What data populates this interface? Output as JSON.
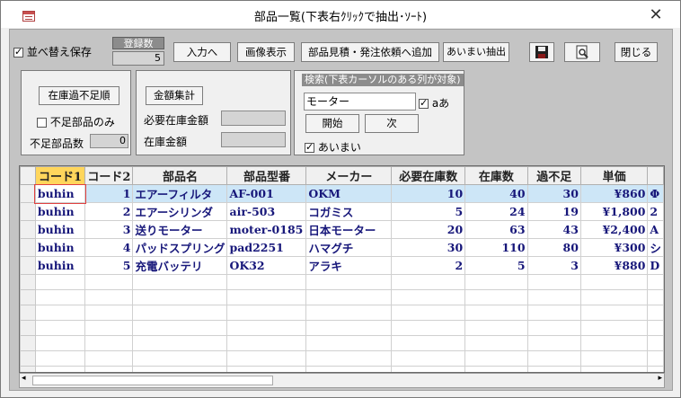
{
  "window": {
    "title": "部品一覧(下表右ｸﾘｯｸで抽出･ｿｰﾄ)"
  },
  "toolbar": {
    "sort_save_label": "並べ替え保存",
    "sort_save_checked": true,
    "count_label": "登録数",
    "count_value": "5",
    "input_label": "入力へ",
    "image_label": "画像表示",
    "estimate_label": "部品見積・発注依頼へ追加",
    "fuzzy_extract_label": "あいまい抽出",
    "close_label": "閉じる"
  },
  "left_panel": {
    "shortage_sort_label": "在庫過不足順",
    "shortage_only_label": "不足部品のみ",
    "shortage_only_checked": false,
    "shortage_count_label": "不足部品数",
    "shortage_count_value": "0"
  },
  "amount_panel": {
    "total_button": "金額集計",
    "required_label": "必要在庫金額",
    "stock_label": "在庫金額"
  },
  "search": {
    "legend": "検索(下表カーソルのある列が対象)",
    "value": "モーター",
    "case_label": "aあ",
    "case_checked": true,
    "start_label": "開始",
    "next_label": "次",
    "fuzzy_label": "あいまい",
    "fuzzy_checked": true
  },
  "grid": {
    "columns": [
      "コード1",
      "コード2",
      "部品名",
      "部品型番",
      "メーカー",
      "必要在庫数",
      "在庫数",
      "過不足",
      "単価",
      ""
    ],
    "rows": [
      [
        "buhin",
        "1",
        "エアーフィルタ",
        "AF-001",
        "OKM",
        "10",
        "40",
        "30",
        "¥860",
        "Φ"
      ],
      [
        "buhin",
        "2",
        "エアーシリンダ",
        "air-503",
        "コガミス",
        "5",
        "24",
        "19",
        "¥1,800",
        "2"
      ],
      [
        "buhin",
        "3",
        "送りモーター",
        "moter-0185",
        "日本モーター",
        "20",
        "63",
        "43",
        "¥2,400",
        "A"
      ],
      [
        "buhin",
        "4",
        "パッドスプリング",
        "pad2251",
        "ハマグチ",
        "30",
        "110",
        "80",
        "¥300",
        "シ"
      ],
      [
        "buhin",
        "5",
        "充電バッテリ",
        "OK32",
        "アラキ",
        "2",
        "5",
        "3",
        "¥880",
        "D"
      ]
    ]
  }
}
